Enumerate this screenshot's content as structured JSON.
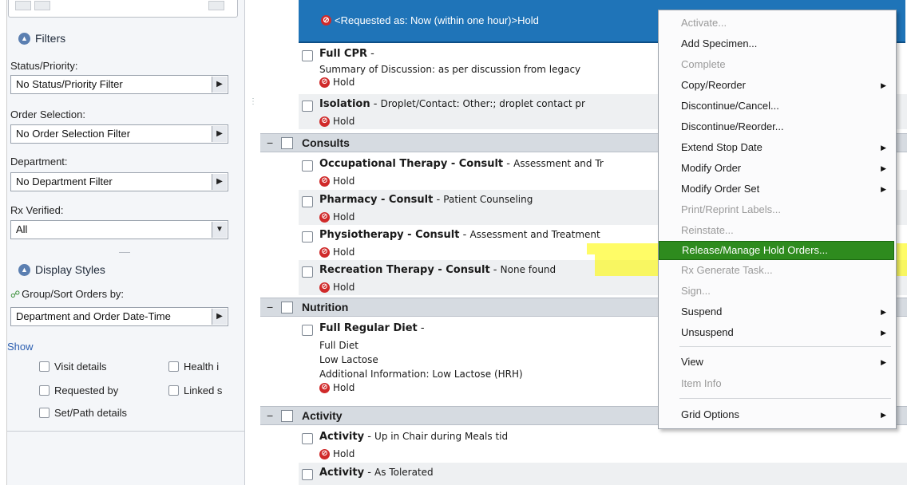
{
  "left": {
    "filters_title": "Filters",
    "status_label": "Status/Priority:",
    "status_value": "No Status/Priority Filter",
    "order_sel_label": "Order Selection:",
    "order_sel_value": "No Order Selection Filter",
    "dept_label": "Department:",
    "dept_value": "No Department Filter",
    "rx_label": "Rx Verified:",
    "rx_value": "All",
    "display_title": "Display Styles",
    "group_label": "Group/Sort Orders by:",
    "group_value": "Department and Order Date-Time",
    "show_label": "Show",
    "checks": [
      "Visit details",
      "Health i",
      "Requested by",
      "Linked s",
      "Set/Path details"
    ]
  },
  "orders": {
    "top_hold": "<Requested as: Now (within one hour)>Hold",
    "full_cpr": "Full CPR",
    "full_cpr_detail": "Summary of Discussion:  as per discussion  from legacy",
    "hold": "Hold",
    "isolation": "Isolation",
    "isolation_detail": "Droplet/Contact: Other:; droplet contact pr",
    "consults": "Consults",
    "ot": "Occupational Therapy - Consult",
    "ot_detail": "Assessment  and Tr",
    "pharm": "Pharmacy - Consult",
    "pharm_detail": "Patient Counseling",
    "physio": "Physiotherapy - Consult",
    "physio_detail": "Assessment  and Treatment",
    "rec": "Recreation Therapy - Consult",
    "rec_detail": "None found",
    "nutrition": "Nutrition",
    "diet": "Full Regular Diet",
    "diet_l1": "Full Diet",
    "diet_l2": "Low Lactose",
    "diet_l3": "Additional  Information:  Low Lactose  (HRH)",
    "activity_cat": "Activity",
    "act1": "Activity",
    "act1_detail": "Up in Chair during Meals tid",
    "act2": "Activity",
    "act2_detail": "As Tolerated",
    "dash": "-"
  },
  "menu": {
    "items": [
      "Activate...",
      "Add Specimen...",
      "Complete",
      "Copy/Reorder",
      "Discontinue/Cancel...",
      "Discontinue/Reorder...",
      "Extend Stop Date",
      "Modify Order",
      "Modify Order Set",
      "Print/Reprint Labels...",
      "Reinstate...",
      "Release/Manage Hold Orders...",
      "Rx Generate Task...",
      "Sign...",
      "Suspend",
      "Unsuspend",
      "View",
      "Item Info",
      "Grid Options"
    ]
  },
  "colors": {
    "selected_row": "#1f74b8",
    "menu_highlight": "#2e8b1e",
    "hold_icon": "#d02a2a",
    "highlighter": "#fffa00"
  }
}
